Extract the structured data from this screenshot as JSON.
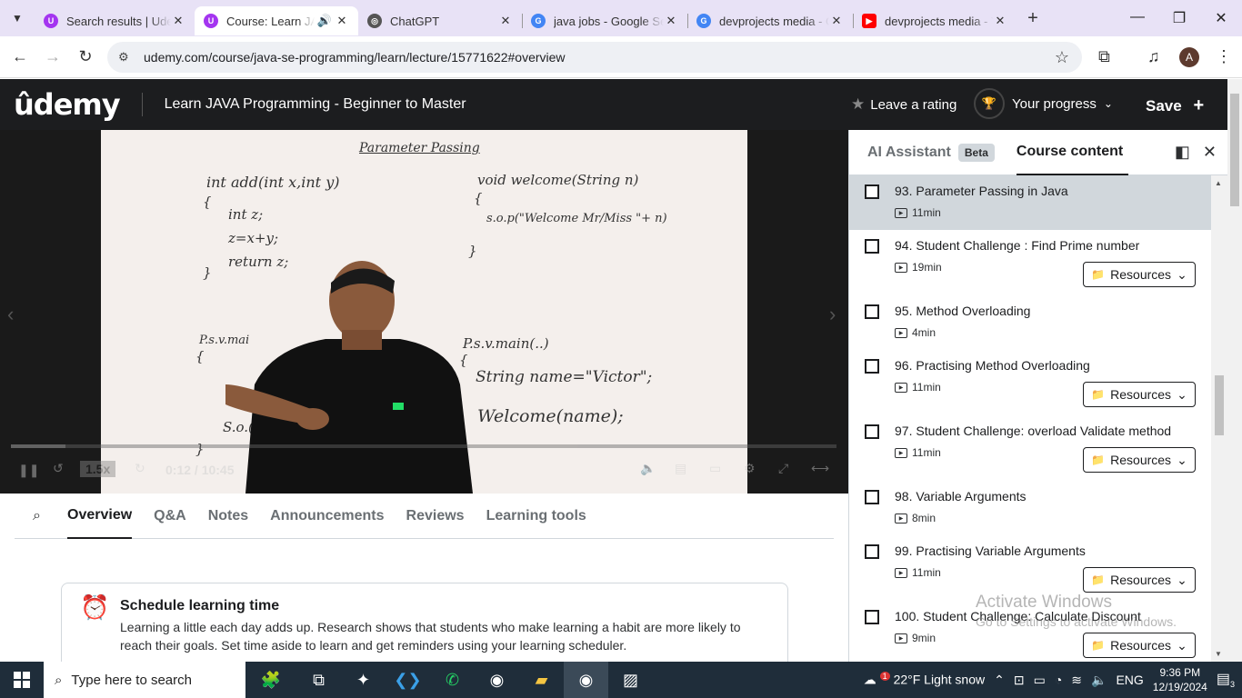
{
  "browser": {
    "tabs": [
      {
        "title": "Search results | Udemy",
        "favicon": "udemy-icon",
        "active": false
      },
      {
        "title": "Course: Learn JAVA Programming",
        "favicon": "udemy-icon",
        "active": true
      },
      {
        "title": "ChatGPT",
        "favicon": "chatgpt-icon",
        "active": false
      },
      {
        "title": "java jobs - Google Search",
        "favicon": "google-icon",
        "active": false
      },
      {
        "title": "devprojects media - Google Search",
        "favicon": "google-icon",
        "active": false
      },
      {
        "title": "devprojects media - YouTube",
        "favicon": "youtube-icon",
        "active": false
      }
    ],
    "url": "udemy.com/course/java-se-programming/learn/lecture/15771622#overview",
    "profile_initial": "A"
  },
  "header": {
    "logo": "ûdemy",
    "course_title": "Learn JAVA Programming - Beginner to Master",
    "leave_rating": "Leave a rating",
    "your_progress": "Your progress",
    "save": "Save"
  },
  "video": {
    "board_title": "Parameter Passing",
    "speed": "1.5x",
    "time": "0:12 / 10:45",
    "chalk": {
      "l1": "int add(int x,int y)",
      "l2": "{",
      "l3": "int z;",
      "l4": "z=x+y;",
      "l5": "return z;",
      "l6": "}",
      "r1": "void welcome(String n)",
      "r2": "{",
      "r3": "s.o.p(\"Welcome Mr/Miss \"+ n)",
      "r4": "}",
      "m1": "P.s.v.main(..)",
      "m2": "{",
      "m3": "String name=\"Victor\";",
      "m4": "Welcome(name);",
      "lm": "P.s.v.mai",
      "lm2": "{",
      "so": "S.o.(",
      "lb": "}"
    }
  },
  "course_tabs": [
    "Overview",
    "Q&A",
    "Notes",
    "Announcements",
    "Reviews",
    "Learning tools"
  ],
  "schedule": {
    "title": "Schedule learning time",
    "text": "Learning a little each day adds up. Research shows that students who make learning a habit are more likely to reach their goals. Set time aside to learn and get reminders using your learning scheduler."
  },
  "sidebar": {
    "ai_tab": "AI Assistant",
    "beta": "Beta",
    "content_tab": "Course content",
    "resources_label": "Resources",
    "lectures": [
      {
        "title": "93. Parameter Passing in Java",
        "duration": "11min",
        "resources": false,
        "current": true
      },
      {
        "title": "94. Student Challenge : Find Prime number",
        "duration": "19min",
        "resources": true,
        "current": false
      },
      {
        "title": "95. Method Overloading",
        "duration": "4min",
        "resources": false,
        "current": false
      },
      {
        "title": "96. Practising Method Overloading",
        "duration": "11min",
        "resources": true,
        "current": false
      },
      {
        "title": "97. Student Challenge: overload Validate method",
        "duration": "11min",
        "resources": true,
        "current": false
      },
      {
        "title": "98. Variable Arguments",
        "duration": "8min",
        "resources": false,
        "current": false
      },
      {
        "title": "99. Practising Variable Arguments",
        "duration": "11min",
        "resources": true,
        "current": false
      },
      {
        "title": "100. Student Challenge: Calculate Discount",
        "duration": "9min",
        "resources": true,
        "current": false
      }
    ]
  },
  "watermark": {
    "line1": "Activate Windows",
    "line2": "Go to Settings to activate Windows."
  },
  "taskbar": {
    "search_placeholder": "Type here to search",
    "weather": "22°F  Light snow",
    "weather_badge": "1",
    "language": "ENG",
    "time": "9:36 PM",
    "date": "12/19/2024",
    "notifications": "3"
  }
}
